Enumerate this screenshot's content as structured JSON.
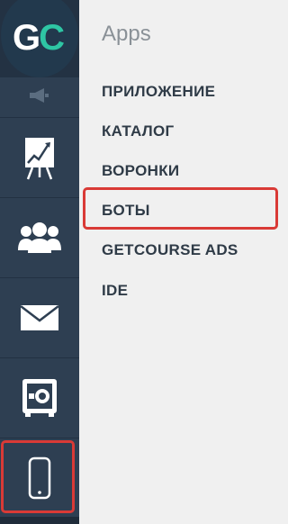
{
  "logo": {
    "letter1": "G",
    "letter2": "C"
  },
  "sidebar": {
    "items": [
      {
        "icon": "megaphone-icon"
      },
      {
        "icon": "presentation-chart-icon"
      },
      {
        "icon": "users-group-icon"
      },
      {
        "icon": "envelope-icon"
      },
      {
        "icon": "safe-icon"
      },
      {
        "icon": "mobile-phone-icon",
        "active": true
      }
    ]
  },
  "panel": {
    "title": "Apps",
    "items": [
      {
        "label": "ПРИЛОЖЕНИЕ"
      },
      {
        "label": "КАТАЛОГ"
      },
      {
        "label": "ВОРОНКИ"
      },
      {
        "label": "БОТЫ",
        "highlighted": true
      },
      {
        "label": "GETCOURSE ADS"
      },
      {
        "label": "IDE"
      }
    ]
  },
  "colors": {
    "sidebar_bg": "#2e3f52",
    "logo_accent": "#2ec6a4",
    "highlight": "#d93a36",
    "menu_text": "#2f3b47",
    "title_text": "#8a9197"
  }
}
